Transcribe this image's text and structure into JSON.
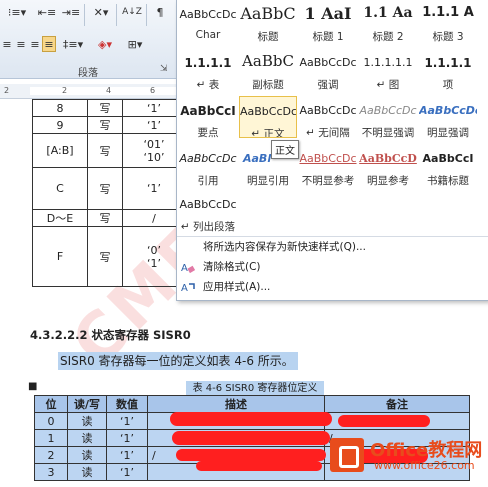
{
  "ribbon": {
    "group_label": "段落",
    "row1": [
      "⁝≡▾",
      "⇤≡",
      "⇥≡",
      "✕▾",
      "A↓Z",
      "¶"
    ],
    "row2": [
      "≡",
      "≡",
      "≡",
      "≡",
      "‡≡▾",
      "◈▾",
      "⊞▾"
    ]
  },
  "ruler": {
    "ticks": [
      "2",
      "2",
      "4",
      "6"
    ]
  },
  "table1": {
    "rows": [
      [
        "8",
        "写",
        "‘1’"
      ],
      [
        "9",
        "写",
        "‘1’"
      ],
      [
        "[A:B]",
        "写",
        "‘01’\n‘10’"
      ],
      [
        "C",
        "写",
        "‘1’"
      ],
      [
        "D～E",
        "写",
        "/"
      ],
      [
        "F",
        "写",
        "‘0’\n‘1’"
      ]
    ]
  },
  "heading": "4.3.2.2.2  状态寄存器 SISR0",
  "paragraph": "SISR0 寄存器每一位的定义如表  4-6 所示。",
  "caption": "表  4-6 SISR0 寄存器位定义",
  "table2": {
    "headers": [
      "位",
      "读/写",
      "数值",
      "描述",
      "备注"
    ],
    "rows": [
      [
        "0",
        "读",
        "‘1’",
        "",
        ""
      ],
      [
        "1",
        "读",
        "‘1’",
        "",
        "/"
      ],
      [
        "2",
        "读",
        "‘1’",
        "/",
        ""
      ],
      [
        "3",
        "读",
        "‘1’",
        "",
        ""
      ]
    ]
  },
  "gallery": {
    "tiles": [
      {
        "preview": "AaBbCcDc",
        "name": "Char"
      },
      {
        "preview": "AaBbC",
        "name": "标题"
      },
      {
        "preview": "1  AaI",
        "name": "标题 1"
      },
      {
        "preview": "1.1  Aa",
        "name": "标题 2"
      },
      {
        "preview": "1.1.1  A",
        "name": "标题 3"
      },
      {
        "preview": "1.1.1.1",
        "name": "↵ 表"
      },
      {
        "preview": "AaBbC",
        "name": "副标题"
      },
      {
        "preview": "AaBbCcDc",
        "name": "强调"
      },
      {
        "preview": "1.1.1.1.1",
        "name": "↵ 图"
      },
      {
        "preview": "1.1.1.1",
        "name": "项"
      },
      {
        "preview": "AaBbCcI",
        "name": "要点"
      },
      {
        "preview": "AaBbCcDc",
        "name": "↵ 正文"
      },
      {
        "preview": "AaBbCcDc",
        "name": "↵ 无间隔"
      },
      {
        "preview": "AaBbCcDc",
        "name": "不明显强调"
      },
      {
        "preview": "AaBbCcDc",
        "name": "明显强调"
      },
      {
        "preview": "AaBbCcDc",
        "name": "引用"
      },
      {
        "preview": "AaBl",
        "name": "明显引用"
      },
      {
        "preview": "AaBbCcDc",
        "name": "不明显参考"
      },
      {
        "preview": "AaBbCcD",
        "name": "明显参考"
      },
      {
        "preview": "AaBbCcI",
        "name": "书籍标题"
      },
      {
        "preview": "AaBbCcDc",
        "name": "↵ 列出段落"
      }
    ],
    "tooltip": "正文",
    "menu": [
      {
        "label": "将所选内容保存为新快速样式(Q)...",
        "icon": ""
      },
      {
        "label": "清除格式(C)",
        "icon": "clear-format-icon"
      },
      {
        "label": "应用样式(A)...",
        "icon": "apply-styles-icon"
      }
    ]
  },
  "logo": {
    "text": "Office教程网",
    "url": "www.office26.com"
  },
  "colors": {
    "highlight": "#b8d3f0",
    "redact": "#ff1f1f",
    "logo": "#e84c1c",
    "accent": "#e8c04a"
  }
}
